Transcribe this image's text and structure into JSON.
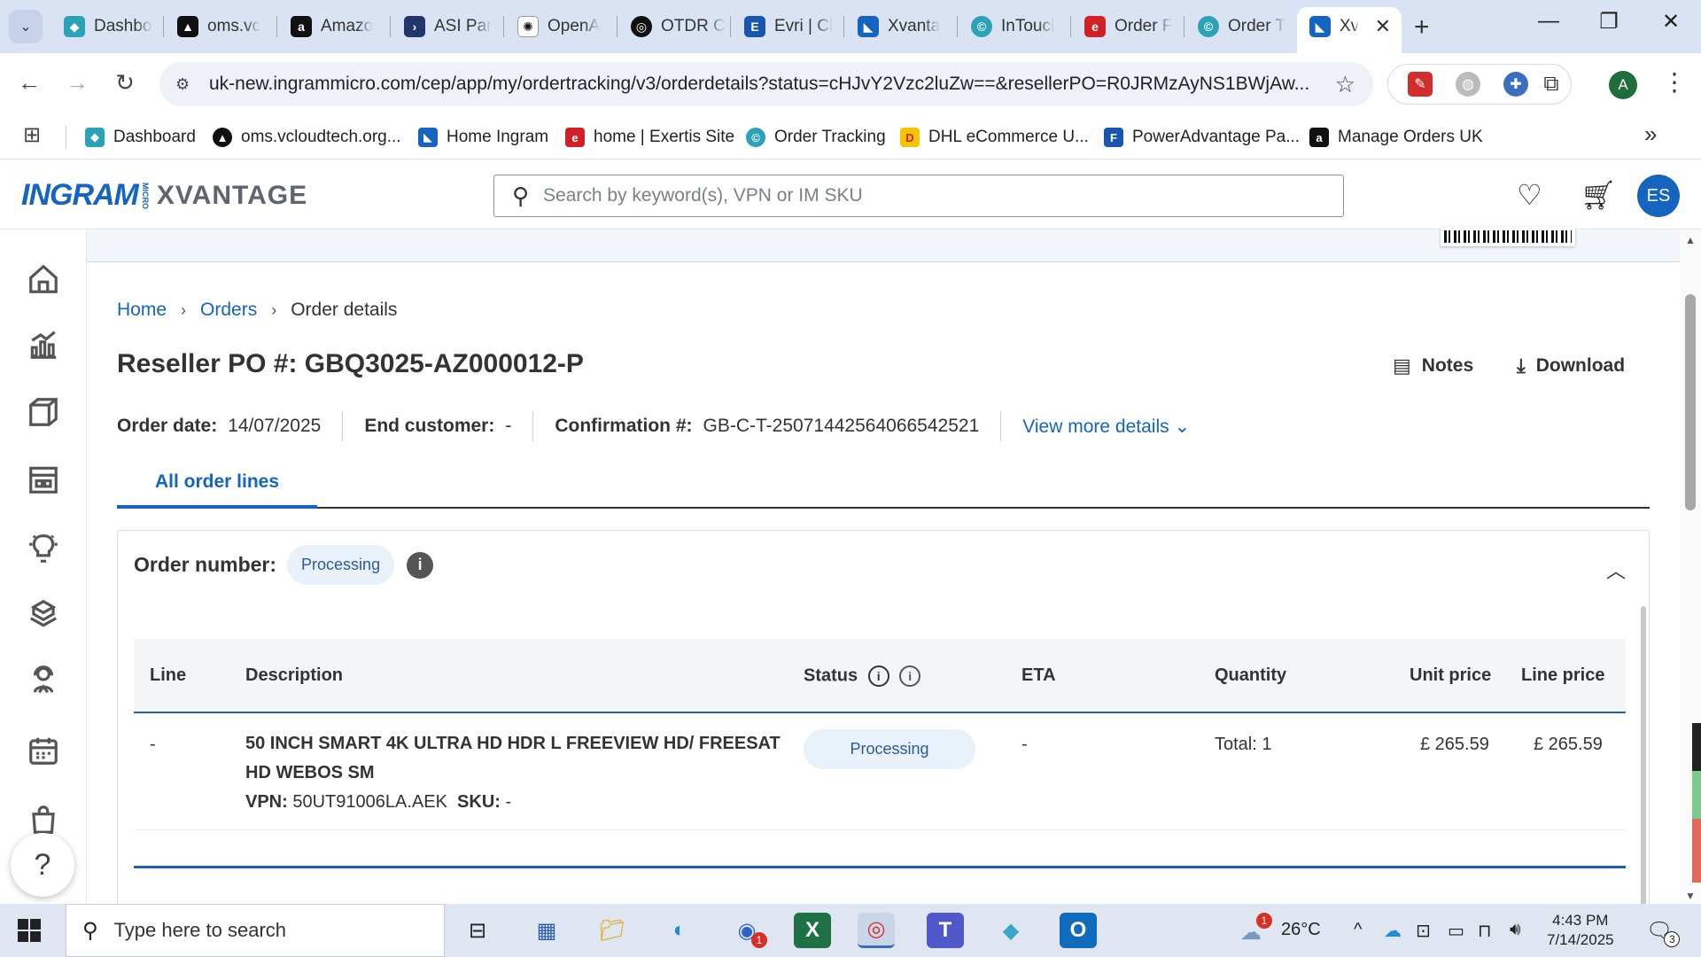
{
  "browser": {
    "tabs": [
      {
        "title": "Dashbo",
        "icon": "dashboard-favicon",
        "color": "#2aa3b8",
        "glyph": "◆"
      },
      {
        "title": "oms.vc",
        "icon": "vcloud-favicon",
        "color": "#111111",
        "glyph": "▲"
      },
      {
        "title": "Amazo",
        "icon": "amazon-favicon",
        "color": "#111111",
        "glyph": "a"
      },
      {
        "title": "ASI Par",
        "icon": "asi-favicon",
        "color": "#23366b",
        "glyph": "›"
      },
      {
        "title": "OpenA",
        "icon": "openai-favicon",
        "color": "#ffffff",
        "glyph": "✺"
      },
      {
        "title": "OTDR C",
        "icon": "otdr-favicon",
        "color": "#111111",
        "glyph": "◎"
      },
      {
        "title": "Evri | Cl",
        "icon": "evri-favicon",
        "color": "#1a55b0",
        "glyph": "E"
      },
      {
        "title": "Xvanta",
        "icon": "xvantage-favicon",
        "color": "#1464c0",
        "glyph": "◣"
      },
      {
        "title": "InToucl",
        "icon": "intouch-favicon",
        "color": "#2aa3b8",
        "glyph": "©"
      },
      {
        "title": "Order F",
        "icon": "exertis-favicon",
        "color": "#d22027",
        "glyph": "e"
      },
      {
        "title": "Order T",
        "icon": "ordertracking-favicon",
        "color": "#2aa3b8",
        "glyph": "©"
      },
      {
        "title": "Xv",
        "icon": "xvantage-favicon",
        "color": "#1464c0",
        "glyph": "◣"
      }
    ],
    "url": "uk-new.ingrammicro.com/cep/app/my/ordertracking/v3/orderdetails?status=cHJvY2Vzc2luZw==&resellerPO=R0JRMzAyNS1BWjAw...",
    "profile_initial": "A",
    "bookmarks": [
      {
        "label": "Dashboard",
        "color": "#2aa3b8",
        "glyph": "◆"
      },
      {
        "label": "oms.vcloudtech.org...",
        "color": "#111111",
        "glyph": "▲"
      },
      {
        "label": "Home Ingram",
        "color": "#1464c0",
        "glyph": "◣"
      },
      {
        "label": "home | Exertis Site",
        "color": "#d22027",
        "glyph": "e"
      },
      {
        "label": "Order Tracking",
        "color": "#2aa3b8",
        "glyph": "©"
      },
      {
        "label": "DHL eCommerce U...",
        "color": "#f5c400",
        "glyph": "D"
      },
      {
        "label": "PowerAdvantage Pa...",
        "color": "#1a55b0",
        "glyph": "F"
      },
      {
        "label": "Manage Orders UK",
        "color": "#111111",
        "glyph": "a"
      }
    ]
  },
  "app": {
    "logo_ingram": "INGRAM",
    "logo_micro": "MICRO",
    "logo_xvantage": "XVANTAGE",
    "search_placeholder": "Search by keyword(s), VPN or IM SKU",
    "avatar_initials": "ES",
    "breadcrumb": {
      "home": "Home",
      "orders": "Orders",
      "current": "Order details"
    },
    "po_title": "Reseller PO #: GBQ3025-AZ000012-P",
    "actions": {
      "notes": "Notes",
      "download": "Download"
    },
    "meta": {
      "order_date_label": "Order date:",
      "order_date": "14/07/2025",
      "end_customer_label": "End customer:",
      "end_customer": "-",
      "confirmation_label": "Confirmation #:",
      "confirmation": "GB-C-T-25071442564066542521",
      "view_more": "View more details"
    },
    "tabs": {
      "all_order_lines": "All order lines"
    },
    "order": {
      "number_label": "Order number:",
      "status": "Processing",
      "columns": {
        "line": "Line",
        "description": "Description",
        "status": "Status",
        "eta": "ETA",
        "quantity": "Quantity",
        "unit_price": "Unit price",
        "line_price": "Line price"
      },
      "lines": [
        {
          "line": "-",
          "description": "50 INCH SMART 4K ULTRA HD HDR L FREEVIEW HD/ FREESAT HD WEBOS SM",
          "vpn_label": "VPN:",
          "vpn": "50UT91006LA.AEK",
          "sku_label": "SKU:",
          "sku": "-",
          "status": "Processing",
          "eta": "-",
          "quantity": "Total: 1",
          "unit_price": "£ 265.59",
          "line_price": "£ 265.59"
        }
      ]
    }
  },
  "taskbar": {
    "search_text": "Type here to search",
    "weather": "26°C",
    "weather_badge": "1",
    "zoom_badge": "1",
    "time": "4:43 PM",
    "date": "7/14/2025",
    "notification_count": "3"
  }
}
